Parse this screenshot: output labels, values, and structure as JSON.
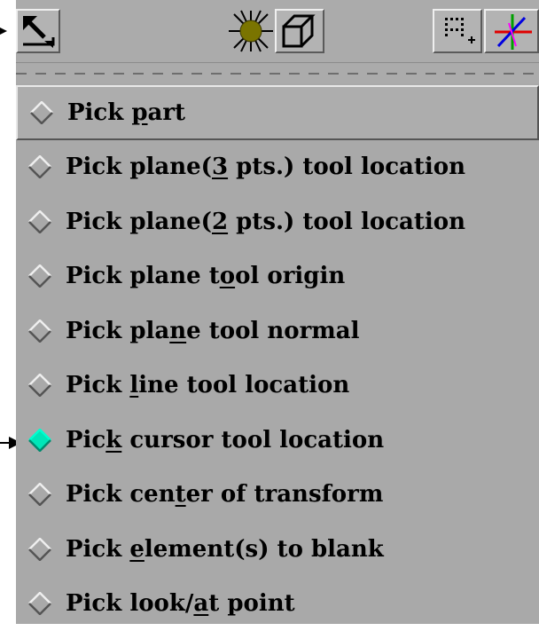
{
  "toolbar": {
    "icons": [
      "pick-mode-icon",
      "light-icon",
      "box-icon",
      "select-region-icon",
      "axis-triad-icon"
    ]
  },
  "menu": {
    "items": [
      {
        "before": "Pick ",
        "mn": "p",
        "after": "art",
        "selected": false
      },
      {
        "before": "Pick plane(",
        "mn": "3",
        "after": " pts.) tool location",
        "selected": false
      },
      {
        "before": "Pick plane(",
        "mn": "2",
        "after": " pts.) tool location",
        "selected": false
      },
      {
        "before": "Pick plane t",
        "mn": "o",
        "after": "ol origin",
        "selected": false
      },
      {
        "before": "Pick pla",
        "mn": "n",
        "after": "e tool normal",
        "selected": false
      },
      {
        "before": "Pick ",
        "mn": "l",
        "after": "ine tool location",
        "selected": false
      },
      {
        "before": "Pic",
        "mn": "k",
        "after": " cursor tool location",
        "selected": true
      },
      {
        "before": "Pick cen",
        "mn": "t",
        "after": "er of transform",
        "selected": false
      },
      {
        "before": "Pick ",
        "mn": "e",
        "after": "lement(s) to blank",
        "selected": false
      },
      {
        "before": "Pick look/",
        "mn": "a",
        "after": "t point",
        "selected": false
      }
    ]
  },
  "colors": {
    "selected_indicator": "#00e6b8",
    "panel": "#a9a9a9"
  }
}
